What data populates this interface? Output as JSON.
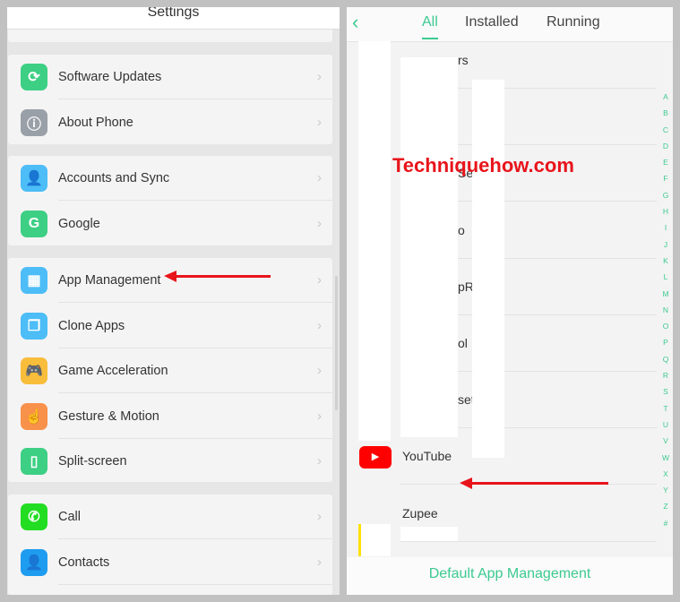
{
  "settings": {
    "title": "Settings",
    "groups": [
      [
        {
          "label": "Software Updates",
          "icon": "refresh-icon",
          "color": "#3dcf84"
        },
        {
          "label": "About Phone",
          "icon": "info-icon",
          "color": "#9aa0a8"
        }
      ],
      [
        {
          "label": "Accounts and Sync",
          "icon": "person-icon",
          "color": "#4dbdf7"
        },
        {
          "label": "Google",
          "icon": "google-icon",
          "color": "#3dcf84"
        }
      ],
      [
        {
          "label": "App Management",
          "icon": "grid-icon",
          "color": "#4dbdf7"
        },
        {
          "label": "Clone Apps",
          "icon": "clone-icon",
          "color": "#4dbdf7"
        },
        {
          "label": "Game Acceleration",
          "icon": "gamepad-icon",
          "color": "#f8bd3a"
        },
        {
          "label": "Gesture & Motion",
          "icon": "hand-icon",
          "color": "#f8914a"
        },
        {
          "label": "Split-screen",
          "icon": "phone-split-icon",
          "color": "#3dcf84"
        }
      ],
      [
        {
          "label": "Call",
          "icon": "phone-icon",
          "color": "#22dd22"
        },
        {
          "label": "Contacts",
          "icon": "contact-icon",
          "color": "#1e9cf0"
        }
      ]
    ]
  },
  "apps": {
    "tabs": [
      "All",
      "Installed",
      "Running"
    ],
    "active_tab": "All",
    "rows": [
      "rs",
      "",
      "Ser",
      "o",
      "pR    e",
      "ol",
      "sett",
      "YouTube",
      "Zupee"
    ],
    "index": [
      "A",
      "B",
      "C",
      "D",
      "E",
      "F",
      "G",
      "H",
      "I",
      "J",
      "K",
      "L",
      "M",
      "N",
      "O",
      "P",
      "Q",
      "R",
      "S",
      "T",
      "U",
      "V",
      "W",
      "X",
      "Y",
      "Z",
      "#"
    ],
    "footer": "Default App Management"
  },
  "watermark": "Techniquehow.com",
  "accent": "#3cc98f"
}
